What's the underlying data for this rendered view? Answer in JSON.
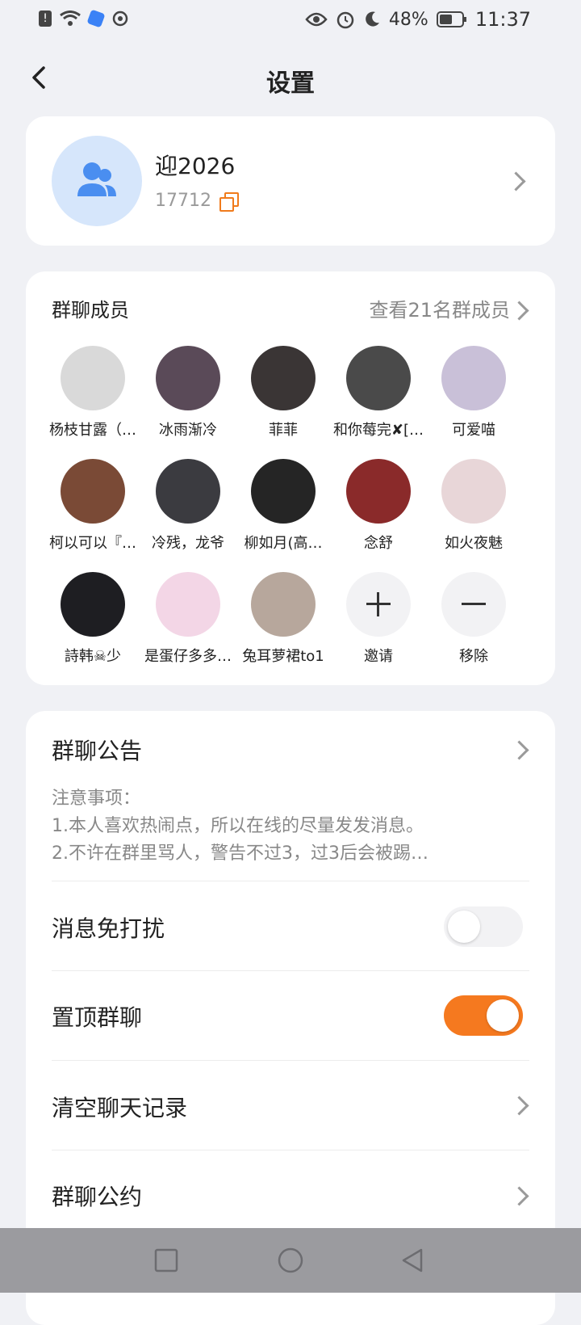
{
  "status": {
    "battery": "48%",
    "time": "11:37"
  },
  "header": {
    "title": "设置"
  },
  "group": {
    "name": "迎2026",
    "id": "17712"
  },
  "members": {
    "title": "群聊成员",
    "view_all": "查看21名群成员",
    "list": [
      {
        "name": "杨枝甘露（…",
        "color": "#d9d9d9"
      },
      {
        "name": "冰雨渐冷",
        "color": "#5a4a58"
      },
      {
        "name": "菲菲",
        "color": "#3a3535"
      },
      {
        "name": "和你莓完✘[…",
        "color": "#4a4a4a"
      },
      {
        "name": "可爱喵",
        "color": "#c9c0d8"
      },
      {
        "name": "柯以可以『…",
        "color": "#7a4a36"
      },
      {
        "name": "冷残，龙爷",
        "color": "#3b3b40"
      },
      {
        "name": "柳如月(高…",
        "color": "#252525"
      },
      {
        "name": "念舒",
        "color": "#8a2a2a"
      },
      {
        "name": "如火夜魅",
        "color": "#e8d6d8"
      },
      {
        "name": "詩韩☠少",
        "color": "#1e1e22"
      },
      {
        "name": "是蛋仔多多…",
        "color": "#f3d6e6"
      },
      {
        "name": "兔耳萝裙to1",
        "color": "#b7a79c"
      }
    ],
    "invite": "邀请",
    "remove": "移除"
  },
  "settings": {
    "notice": {
      "label": "群聊公告",
      "lines": [
        "注意事项：",
        "1.本人喜欢热闹点，所以在线的尽量发发消息。",
        "2.不许在群里骂人，警告不过3，过3后会被踢…"
      ]
    },
    "dnd": {
      "label": "消息免打扰",
      "on": false
    },
    "pin": {
      "label": "置顶群聊",
      "on": true
    },
    "clear": {
      "label": "清空聊天记录"
    },
    "rules": {
      "label": "群聊公约"
    }
  },
  "colors": {
    "accent": "#f5791f",
    "avatar_bg": "#d6e6fb",
    "icon_blue": "#4a8ef0"
  }
}
